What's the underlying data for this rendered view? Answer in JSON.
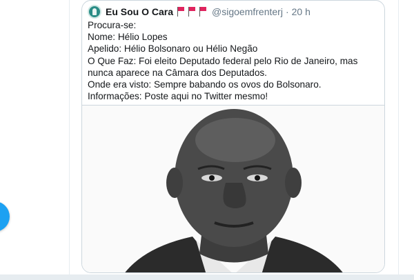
{
  "quote": {
    "display_name": "Eu Sou O Cara",
    "flag_icons": [
      "red-flag-icon",
      "red-flag-icon",
      "red-flag-icon"
    ],
    "handle": "@sigoemfrenterj",
    "separator": "·",
    "time": "20 h",
    "lines": [
      "Procura-se:",
      "Nome: Hélio Lopes",
      "Apelido: Hélio Bolsonaro ou Hélio Negão",
      "O Que Faz: Foi eleito Deputado federal pelo Rio de Janeiro, mas nunca aparece na Câmara dos Deputados.",
      "Onde era visto: Sempre babando os ovos do Bolsonaro.",
      "Informações: Poste aqui no Twitter mesmo!"
    ]
  },
  "colors": {
    "accent": "#1da1f2",
    "flag": "#e0245e",
    "secondary_text": "#657786",
    "border": "#ccd6dd"
  }
}
